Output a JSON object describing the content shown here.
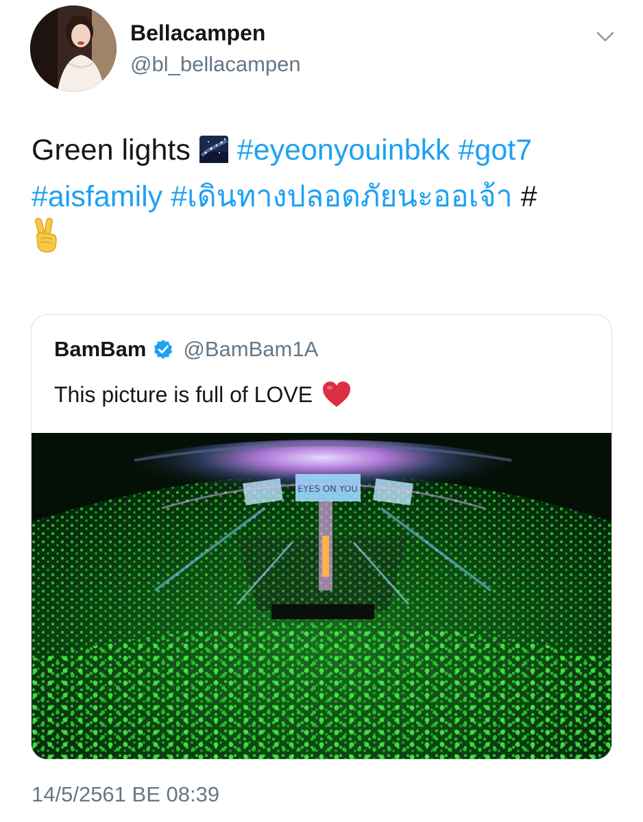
{
  "author": {
    "display_name": "Bellacampen",
    "handle": "@bl_bellacampen",
    "avatar_icon": "profile-photo"
  },
  "tweet": {
    "text_plain": "Green lights",
    "emoji_1": "night-sky-stars-emoji",
    "hashtags": [
      "#eyeonyouinbkk",
      "#got7",
      "#aisfamily",
      "#เดินทางปลอดภัยนะออเจ้า",
      "#"
    ],
    "emoji_2": "victory-hand-emoji"
  },
  "quoted_tweet": {
    "display_name": "BamBam",
    "verified": true,
    "handle": "@BamBam1A",
    "text": "This picture is full of LOVE",
    "emoji": "red-heart-emoji",
    "media": "concert-arena-green-lightsticks-photo",
    "stage_screen_text": "EYES ON YOU"
  },
  "timestamp": "14/5/2561 BE 08:39",
  "colors": {
    "hashtag": "#1da1f2",
    "secondary_text": "#657786",
    "primary_text": "#14171a",
    "border": "#d8dee2",
    "verified": "#1da1f2"
  }
}
